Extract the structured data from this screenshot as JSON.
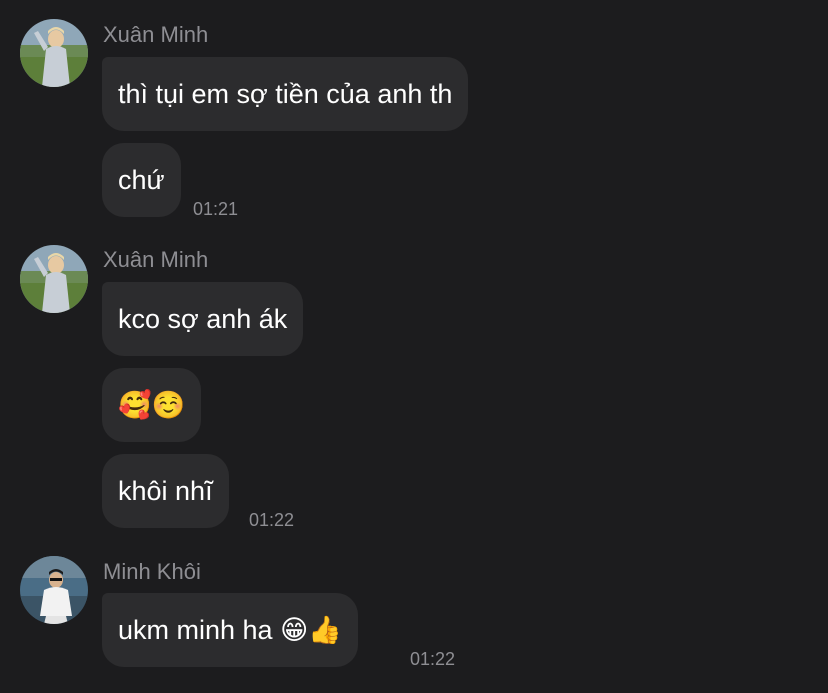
{
  "colors": {
    "background": "#1c1c1e",
    "bubble": "#2c2c2e",
    "text": "#ffffff",
    "meta": "#8e8e93"
  },
  "groups": [
    {
      "sender": "Xuân Minh",
      "avatar": "avatar-xuan-minh",
      "messages": [
        "thì tụi em sợ tiền của anh th",
        "chứ"
      ],
      "time": "01:21"
    },
    {
      "sender": "Xuân Minh",
      "avatar": "avatar-xuan-minh",
      "messages": [
        "kco sợ anh ák",
        "🥰☺️",
        "khôi nhĩ"
      ],
      "time": "01:22"
    },
    {
      "sender": "Minh Khôi",
      "avatar": "avatar-minh-khoi",
      "messages": [
        "ukm minh ha 😁👍"
      ],
      "time": "01:22"
    }
  ]
}
